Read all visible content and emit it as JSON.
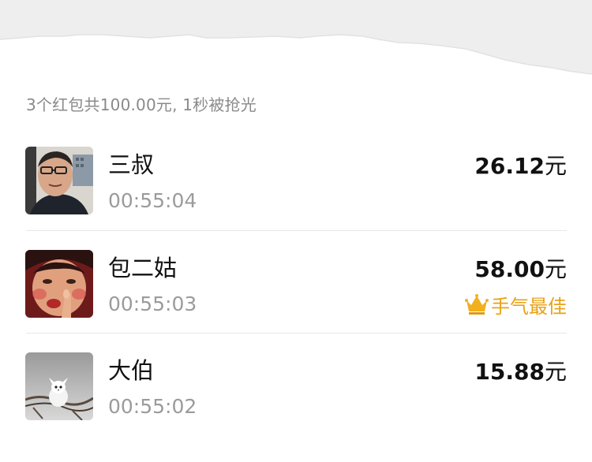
{
  "summary": "3个红包共100.00元, 1秒被抢光",
  "currency_unit": "元",
  "best_badge": {
    "label": "手气最佳",
    "color": "#e9a216",
    "icon": "crown-icon"
  },
  "records": [
    {
      "name": "三叔",
      "time": "00:55:04",
      "amount": "26.12",
      "unit": "元"
    },
    {
      "name": "包二姑",
      "time": "00:55:03",
      "amount": "58.00",
      "unit": "元",
      "best": true
    },
    {
      "name": "大伯",
      "time": "00:55:02",
      "amount": "15.88",
      "unit": "元"
    }
  ]
}
